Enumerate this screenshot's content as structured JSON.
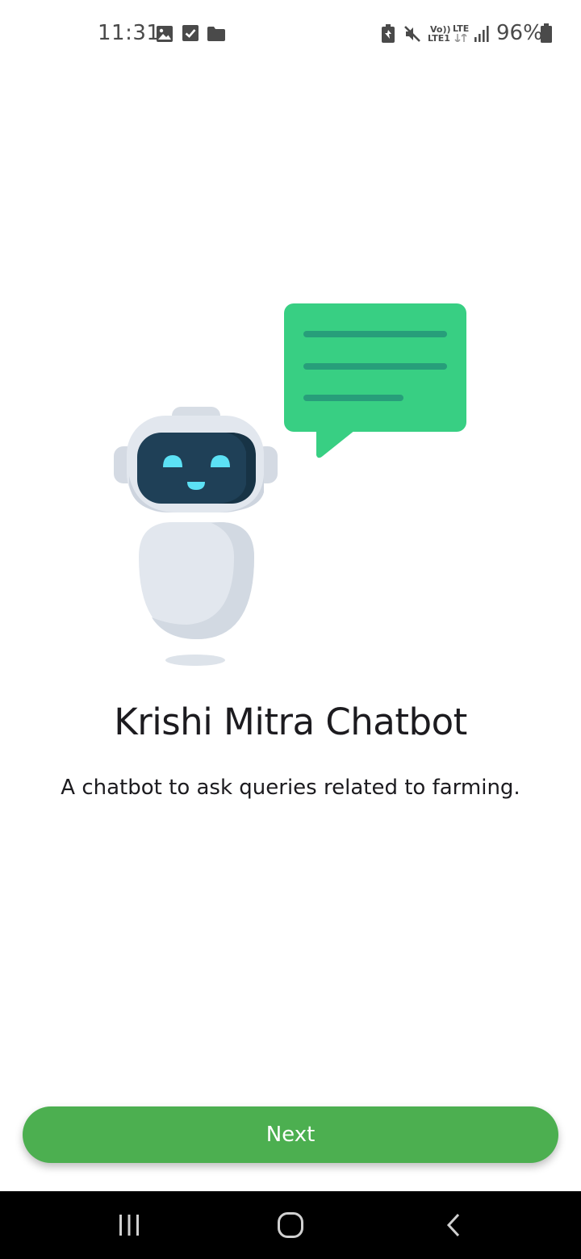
{
  "status_bar": {
    "time": "11:31",
    "battery_percent": "96%",
    "volte_label": "Vo))",
    "lte1_label": "LTE1",
    "lte_label": "LTE",
    "left_icons": [
      "image-icon",
      "checkbox-icon",
      "folder-icon"
    ],
    "right_icons": [
      "battery-saver-icon",
      "mute-icon",
      "volte-icon",
      "lte-data-icon",
      "signal-icon",
      "battery-icon"
    ]
  },
  "onboarding": {
    "title": "Krishi Mitra Chatbot",
    "subtitle": "A chatbot to ask queries related to farming."
  },
  "actions": {
    "next_label": "Next"
  },
  "colors": {
    "button": "#4caf50",
    "bubble": "#38cf83",
    "bubble_lines": "#279e7a",
    "robot_face": "#1f4057",
    "robot_eyes": "#5ce1f5",
    "robot_body": "#e2e7ee"
  },
  "nav_bar": {
    "icons": [
      "recent-apps-icon",
      "home-icon",
      "back-icon"
    ]
  }
}
